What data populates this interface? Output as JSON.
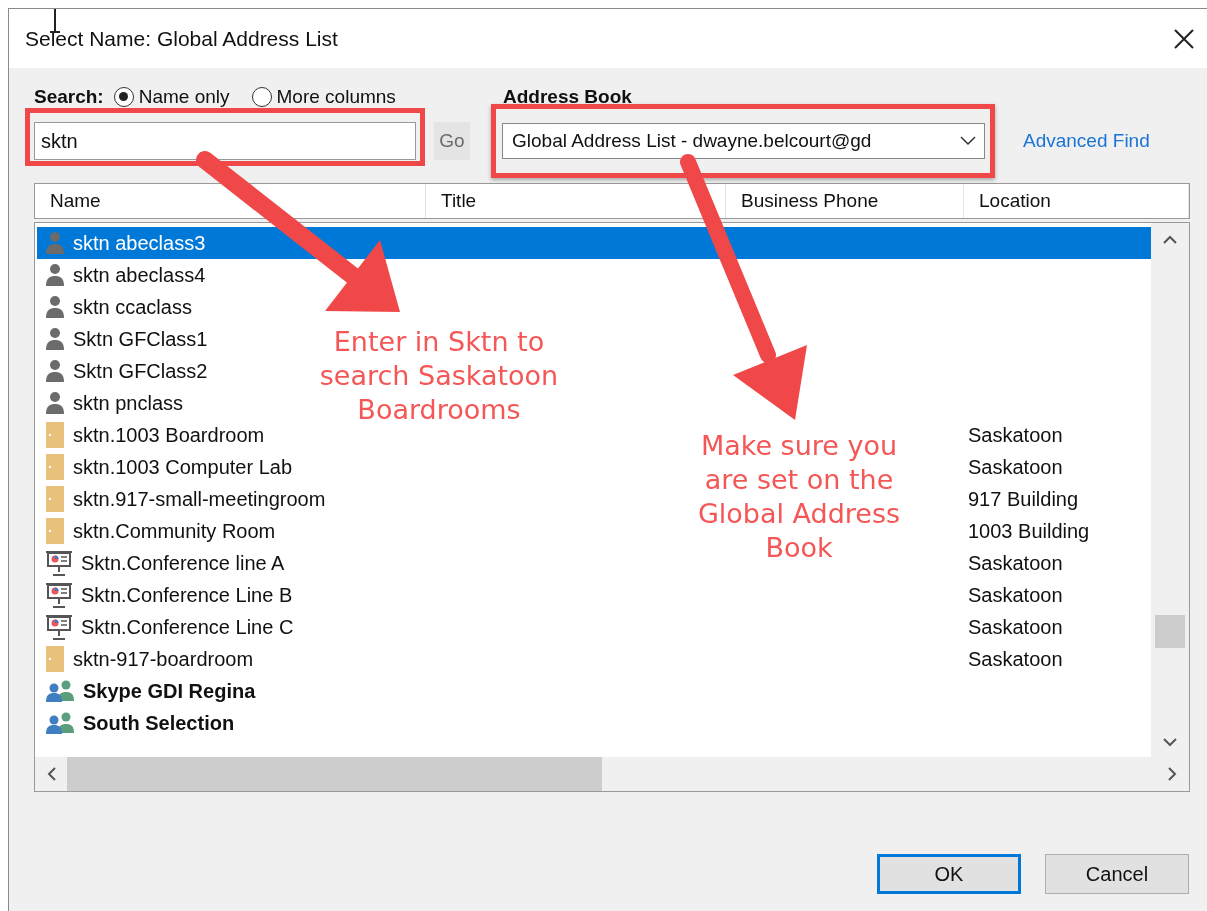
{
  "window": {
    "title": "Select Name: Global Address List"
  },
  "search": {
    "label": "Search:",
    "options": [
      {
        "label": "Name only",
        "selected": true
      },
      {
        "label": "More columns",
        "selected": false
      }
    ],
    "value": "sktn",
    "go_button": {
      "label": "Go",
      "disabled": true
    }
  },
  "address_book": {
    "label": "Address Book",
    "value": "Global Address List - dwayne.belcourt@gd",
    "link": "Advanced Find"
  },
  "table": {
    "columns": [
      "Name",
      "Title",
      "Business Phone",
      "Location"
    ],
    "rows": [
      {
        "name": "sktn abeclass3",
        "kind": "person",
        "selected": true
      },
      {
        "name": "sktn abeclass4",
        "kind": "person",
        "selected": false
      },
      {
        "name": "sktn ccaclass",
        "kind": "person",
        "selected": false
      },
      {
        "name": "Sktn GFClass1",
        "kind": "person",
        "selected": false
      },
      {
        "name": "Sktn GFClass2",
        "kind": "person",
        "selected": false
      },
      {
        "name": "sktn pnclass",
        "kind": "person",
        "selected": false
      },
      {
        "name": "sktn.1003 Boardroom",
        "kind": "room",
        "location": "Saskatoon",
        "selected": false
      },
      {
        "name": "sktn.1003 Computer Lab",
        "kind": "room",
        "location": "Saskatoon",
        "selected": false
      },
      {
        "name": "sktn.917-small-meetingroom",
        "kind": "room",
        "location": "917 Building",
        "selected": false
      },
      {
        "name": "sktn.Community Room",
        "kind": "room",
        "location": "1003 Building",
        "selected": false
      },
      {
        "name": "Sktn.Conference line A",
        "kind": "equipment",
        "location": "Saskatoon",
        "selected": false
      },
      {
        "name": "Sktn.Conference Line B",
        "kind": "equipment",
        "location": "Saskatoon",
        "selected": false
      },
      {
        "name": "Sktn.Conference Line C",
        "kind": "equipment",
        "location": "Saskatoon",
        "selected": false
      },
      {
        "name": "sktn-917-boardroom",
        "kind": "room",
        "location": "Saskatoon",
        "selected": false
      },
      {
        "name": "Skype GDI Regina",
        "kind": "group",
        "selected": false
      },
      {
        "name": "South Selection",
        "kind": "group",
        "selected": false
      }
    ]
  },
  "annotations": [
    {
      "text": "Enter in Sktn to\nsearch Saskatoon\nBoardrooms"
    },
    {
      "text": "Make sure you\nare set on the\nGlobal Address\nBook"
    }
  ],
  "buttons": [
    {
      "label": "OK",
      "default": true
    },
    {
      "label": "Cancel",
      "default": false
    }
  ]
}
